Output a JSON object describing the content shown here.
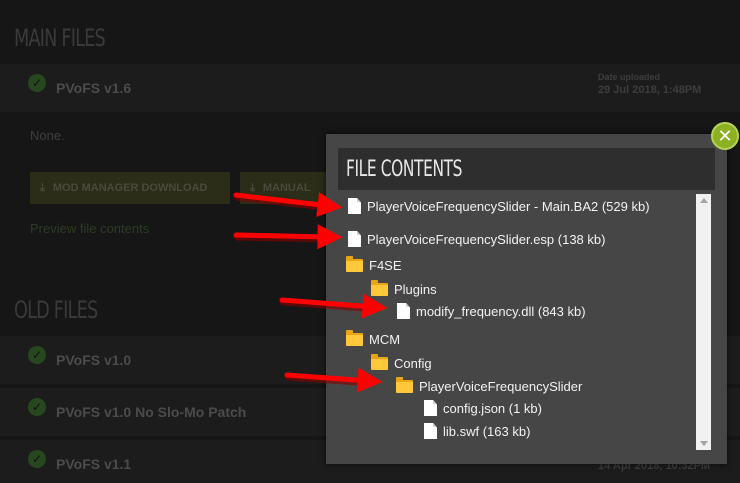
{
  "background": {
    "main_files_heading": "MAIN FILES",
    "old_files_heading": "OLD FILES",
    "main_file": {
      "name": "PVoFS v1.6",
      "date_label": "Date uploaded",
      "date": "29 Jul 2018, 1:48PM",
      "description": "None.",
      "mod_manager_label": "MOD MANAGER DOWNLOAD",
      "manual_label": "MANUAL",
      "preview_label": "Preview file contents"
    },
    "old_files": [
      {
        "name": "PVoFS v1.0"
      },
      {
        "name": "PVoFS v1.0 No Slo-Mo Patch"
      },
      {
        "name": "PVoFS v1.1",
        "date": "14 Apr 2018, 10:32PM"
      }
    ]
  },
  "modal": {
    "title": "FILE CONTENTS",
    "close_symbol": "✕",
    "items": [
      {
        "type": "file",
        "label": "PlayerVoiceFrequencySlider - Main.BA2 (529 kb)",
        "icon": "file-icon"
      },
      {
        "type": "file",
        "label": "PlayerVoiceFrequencySlider.esp (138 kb)",
        "icon": "file-icon"
      },
      {
        "type": "folder",
        "label": "F4SE",
        "icon": "folder-icon"
      },
      {
        "type": "folder",
        "label": "Plugins",
        "icon": "folder-icon"
      },
      {
        "type": "file",
        "label": "modify_frequency.dll (843 kb)",
        "icon": "file-icon"
      },
      {
        "type": "folder",
        "label": "MCM",
        "icon": "folder-icon"
      },
      {
        "type": "folder",
        "label": "Config",
        "icon": "folder-icon"
      },
      {
        "type": "folder",
        "label": "PlayerVoiceFrequencySlider",
        "icon": "folder-icon"
      },
      {
        "type": "file",
        "label": "config.json (1 kb)",
        "icon": "file-icon"
      },
      {
        "type": "file",
        "label": "lib.swf (163 kb)",
        "icon": "file-icon"
      }
    ]
  },
  "colors": {
    "modal_bg": "#464646",
    "header_bg": "#2e2e2e",
    "close_green": "#8cb022",
    "arrow_red": "#ff0000",
    "folder_yellow": "#ffc83a"
  }
}
